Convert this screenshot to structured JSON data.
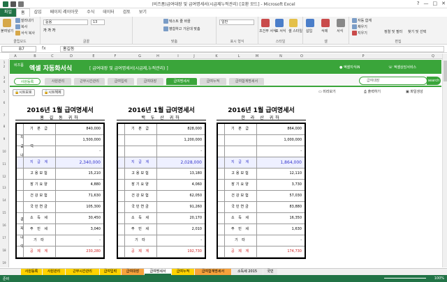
{
  "window": {
    "title": "(비즈폼)급여대장 및 급여명세서(시급제누적관리) [호환 모드] - Microsoft Excel",
    "controls": [
      "?",
      "—",
      "□",
      "✕"
    ]
  },
  "ribbon_tabs": [
    "파일",
    "홈",
    "삽입",
    "페이지 레이아웃",
    "수식",
    "데이터",
    "검토",
    "보기"
  ],
  "ribbon": {
    "clipboard": {
      "paste": "붙여넣기",
      "cut": "잘라내기",
      "copy": "복사",
      "format_painter": "서식 복사",
      "label": "클립보드"
    },
    "font": {
      "font_name": "돋움",
      "font_size": "13",
      "label": "글꼴"
    },
    "alignment": {
      "wrap": "텍스트 줄 바꿈",
      "merge": "병합하고 가운데 맞춤",
      "label": "맞춤"
    },
    "number": {
      "format": "일반",
      "label": "표시 형식"
    },
    "styles": {
      "conditional": "조건부 서식",
      "table": "표 서식",
      "cell": "셀 스타일",
      "label": "스타일"
    },
    "cells": {
      "insert": "삽입",
      "delete": "삭제",
      "format": "서식",
      "label": "셀"
    },
    "editing": {
      "autosum": "자동 합계",
      "fill": "채우기",
      "clear": "지우기",
      "sort": "정렬 및 필터",
      "find": "찾기 및 선택",
      "label": "편집"
    }
  },
  "formula_bar": {
    "name_box": "B7",
    "fx": "fx",
    "value": "홍길동"
  },
  "columns": [
    "A",
    "B",
    "C",
    "D",
    "E",
    "F",
    "G",
    "H",
    "I",
    "J",
    "K",
    "L",
    "M",
    "N",
    "O",
    "P",
    "Q"
  ],
  "rows": [
    "1",
    "2",
    "3",
    "4",
    "5",
    "6",
    "7",
    "8",
    "9",
    "10",
    "11",
    "12",
    "13",
    "14",
    "15",
    "16",
    "17",
    "18",
    "19"
  ],
  "banner": {
    "brand": "비즈폼",
    "app_name": "엑셀 자동화서식",
    "subtitle": "[ 급여대장 및 급여명세서(시급제,누적관리) ]",
    "link_knowledge": "엑셀지식iN",
    "link_service": "엑셀상담서비스"
  },
  "menu": [
    "사원등록",
    "사원관리",
    "근무시간관리",
    "급여입력",
    "급여대장",
    "급여명세서",
    "급여누적",
    "급여합계명세서"
  ],
  "search": {
    "placeholder": "급여대장",
    "button": "search"
  },
  "toolbar": {
    "protect": "시트보호",
    "unprotect": "시트해제",
    "preview": "미리보기",
    "print": "출력하기",
    "file": "파일생성"
  },
  "slips": [
    {
      "title": "2016년 1월 급여명세서",
      "name": "홍 길 동  귀하",
      "cat_pay": "지급내역",
      "cat_ded": "공제내역",
      "items": [
        {
          "label": "기 본 급",
          "value": "840,000"
        },
        {
          "label": "",
          "value": "1,500,000"
        },
        {
          "label": "",
          "value": "-"
        },
        {
          "label": "지 급 계",
          "value": "2,340,000",
          "style": "total"
        },
        {
          "label": "고용보험",
          "value": "15,210"
        },
        {
          "label": "장기요양",
          "value": "4,880"
        },
        {
          "label": "건강보험",
          "value": "71,630"
        },
        {
          "label": "국민연금",
          "value": "105,300"
        },
        {
          "label": "소 득 세",
          "value": "30,450"
        },
        {
          "label": "주 민 세",
          "value": "3,040"
        },
        {
          "label": "기    타",
          "value": "-"
        },
        {
          "label": "공 제 계",
          "value": "230,280",
          "style": "red"
        }
      ]
    },
    {
      "title": "2016년 1월 급여명세서",
      "name": "백 두 산  귀하",
      "cat_pay": "",
      "cat_ded": "",
      "items": [
        {
          "label": "기 본 급",
          "value": "828,000"
        },
        {
          "label": "",
          "value": "1,200,000"
        },
        {
          "label": "",
          "value": "-"
        },
        {
          "label": "지 급 계",
          "value": "2,028,000",
          "style": "total"
        },
        {
          "label": "고용보험",
          "value": "13,180"
        },
        {
          "label": "장기요양",
          "value": "4,060"
        },
        {
          "label": "건강보험",
          "value": "62,050"
        },
        {
          "label": "국민연금",
          "value": "91,260"
        },
        {
          "label": "소 득 세",
          "value": "20,170"
        },
        {
          "label": "주 민 세",
          "value": "2,010"
        },
        {
          "label": "기    타",
          "value": "-"
        },
        {
          "label": "공 제 계",
          "value": "192,730",
          "style": "red"
        }
      ]
    },
    {
      "title": "2016년 1월 급여명세서",
      "name": "한 라 산  귀하",
      "cat_pay": "",
      "cat_ded": "",
      "items": [
        {
          "label": "기 본 급",
          "value": "864,000"
        },
        {
          "label": "",
          "value": "1,000,000"
        },
        {
          "label": "",
          "value": "-"
        },
        {
          "label": "지 급 계",
          "value": "1,864,000",
          "style": "total"
        },
        {
          "label": "고용보험",
          "value": "12,110"
        },
        {
          "label": "장기요양",
          "value": "3,730"
        },
        {
          "label": "건강보험",
          "value": "57,030"
        },
        {
          "label": "국민연금",
          "value": "83,880"
        },
        {
          "label": "소 득 세",
          "value": "16,350"
        },
        {
          "label": "주 민 세",
          "value": "1,630"
        },
        {
          "label": "기    타",
          "value": "-"
        },
        {
          "label": "공 제 계",
          "value": "174,730",
          "style": "red"
        }
      ]
    }
  ],
  "sheet_tabs": [
    {
      "label": "사원등록",
      "color": "yellow"
    },
    {
      "label": "사원관리",
      "color": "yellow"
    },
    {
      "label": "근무시간관리",
      "color": "yellow"
    },
    {
      "label": "급여입력",
      "color": "yellow"
    },
    {
      "label": "급여대장",
      "color": "orange"
    },
    {
      "label": "급여명세서",
      "color": "white"
    },
    {
      "label": "급여누적",
      "color": "yellow"
    },
    {
      "label": "급여합계명세서",
      "color": "orange"
    },
    {
      "label": "소득세 2015",
      "color": "gray"
    },
    {
      "label": "국민",
      "color": "gray"
    }
  ],
  "status": {
    "ready": "준비",
    "zoom": "100%"
  },
  "colors": {
    "excel_green": "#217346",
    "accent_green": "#3aa53a",
    "total_blue": "#3333cc",
    "deduction_red": "#d02020"
  }
}
